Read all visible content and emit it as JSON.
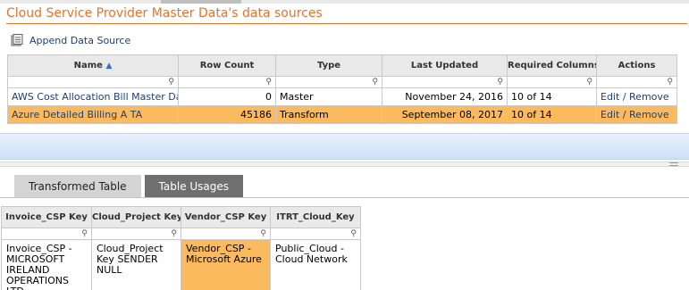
{
  "header": {
    "title": "Cloud Service Provider Master Data's data sources"
  },
  "toolbar": {
    "append_label": "Append Data Source",
    "append_icon": "database-add-icon"
  },
  "data_sources": {
    "columns": [
      "Name",
      "Row Count",
      "Type",
      "Last Updated",
      "Required Columns",
      "Actions"
    ],
    "sorted_by": "Name",
    "rows": [
      {
        "name": "AWS Cost Allocation Bill Master Data",
        "row_count": "0",
        "type": "Master",
        "last_updated": "November 24, 2016",
        "required_columns": "10 of 14",
        "edit": "Edit",
        "sep": "/",
        "remove": "Remove"
      },
      {
        "name": "Azure Detailed Billing A TA",
        "row_count": "45186",
        "type": "Transform",
        "last_updated": "September 08, 2017",
        "required_columns": "10 of 14",
        "edit": "Edit",
        "sep": "/",
        "remove": "Remove"
      }
    ],
    "selected_row": 1
  },
  "tabs": [
    {
      "label": "Transformed Table"
    },
    {
      "label": "Table Usages"
    }
  ],
  "transformed_table": {
    "columns": [
      "Invoice_CSP Key",
      "Cloud_Project Key",
      "Vendor_CSP Key",
      "ITRT_Cloud_Key"
    ],
    "row": [
      "Invoice_CSP - MICROSOFT IRELAND OPERATIONS LTD.",
      "Cloud_Project Key SENDER NULL",
      "Vendor_CSP - Microsoft Azure",
      "Public_Cloud - Cloud Network"
    ]
  },
  "colors": {
    "accent": "#e8712b",
    "selected": "#fbba5d",
    "link": "#1f3e73"
  },
  "filter_icon": "search-icon"
}
